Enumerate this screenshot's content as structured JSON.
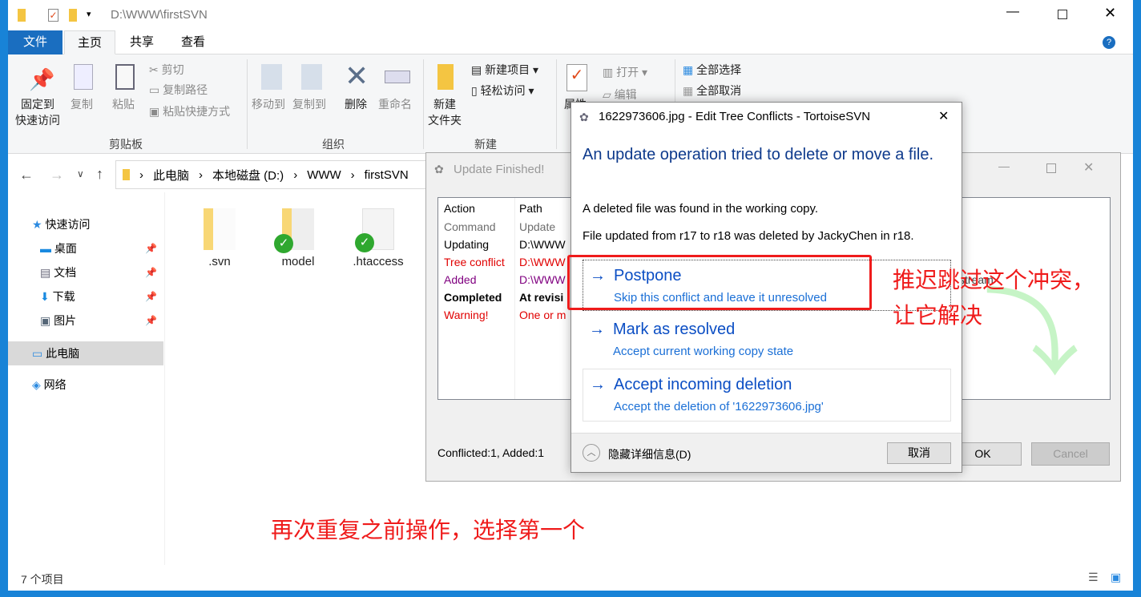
{
  "explorer": {
    "path_title": "D:\\WWW\\firstSVN",
    "tabs": [
      "文件",
      "主页",
      "共享",
      "查看"
    ],
    "ribbon": {
      "pin": "固定到\n快速访问",
      "copy": "复制",
      "paste": "粘贴",
      "cut": "剪切",
      "copy_path": "复制路径",
      "paste_shortcut": "粘贴快捷方式",
      "group_clipboard": "剪贴板",
      "move_to": "移动到",
      "copy_to": "复制到",
      "delete": "删除",
      "rename": "重命名",
      "group_organize": "组织",
      "new_folder": "新建\n文件夹",
      "new_item": "新建项目",
      "easy_access": "轻松访问",
      "group_new": "新建",
      "properties": "属性",
      "open": "打开",
      "edit": "编辑",
      "select_all": "全部选择",
      "select_none": "全部取消"
    },
    "breadcrumb": [
      "此电脑",
      "本地磁盘 (D:)",
      "WWW",
      "firstSVN"
    ],
    "nav": {
      "quick_access": "快速访问",
      "items": [
        "桌面",
        "文档",
        "下载",
        "图片"
      ],
      "this_pc": "此电脑",
      "network": "网络"
    },
    "files": [
      ".svn",
      "model",
      ".htaccess"
    ],
    "status": "7 个项目"
  },
  "update": {
    "title": "Update Finished!",
    "headers": [
      "Action",
      "Path"
    ],
    "rows": [
      {
        "action": "Command",
        "path": "Update",
        "color": "#6d6d6d",
        "bold": false
      },
      {
        "action": "Updating",
        "path": "D:\\WWW",
        "color": "#000000",
        "bold": false
      },
      {
        "action": "Tree conflict",
        "path": "D:\\WWW",
        "color": "#e00000",
        "bold": false
      },
      {
        "action": "Added",
        "path": "D:\\WWW",
        "color": "#800080",
        "bold": false
      },
      {
        "action": "Completed",
        "path": "At revisi",
        "color": "#000000",
        "bold": true
      },
      {
        "action": "Warning!",
        "path": "One or m",
        "color": "#e00000",
        "bold": false
      }
    ],
    "behind_text": "stream",
    "summary": "Conflicted:1, Added:1",
    "ok": "OK",
    "cancel": "Cancel"
  },
  "tree_conflict": {
    "title": "1622973606.jpg - Edit Tree Conflicts - TortoiseSVN",
    "heading": "An update operation tried to delete or move a file.",
    "line1": "A deleted file was found in the working copy.",
    "line2": "File updated from r17 to r18 was deleted by JackyChen in r18.",
    "options": [
      {
        "title": "Postpone",
        "sub": "Skip this conflict and leave it unresolved"
      },
      {
        "title": "Mark as resolved",
        "sub": "Accept current working copy state"
      },
      {
        "title": "Accept incoming deletion",
        "sub": "Accept the deletion of '1622973606.jpg'"
      }
    ],
    "details": "隐藏详细信息(D)",
    "cancel": "取消"
  },
  "annotations": {
    "side1": "推迟跳过这个冲突，",
    "side2": "让它解决",
    "bottom": "再次重复之前操作，选择第一个",
    "color": "#ef1b1b"
  }
}
